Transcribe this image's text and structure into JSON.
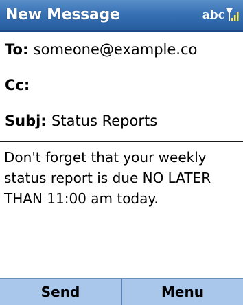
{
  "title_bar": {
    "title": "New Message",
    "input_mode": "abc",
    "signal_icon": "signal-strength-icon"
  },
  "fields": {
    "to_label": "To:",
    "to_value": "someone@example.co",
    "cc_label": "Cc:",
    "cc_value": "",
    "subject_label": "Subj:",
    "subject_value": "Status Reports"
  },
  "message": {
    "body": "Don't forget that your weekly status report is due NO LATER THAN 11:00 am today."
  },
  "softkeys": {
    "left": "Send",
    "right": "Menu"
  },
  "colors": {
    "title_bar": "#3b74b7",
    "softkey_bar": "#a9c7ea"
  }
}
